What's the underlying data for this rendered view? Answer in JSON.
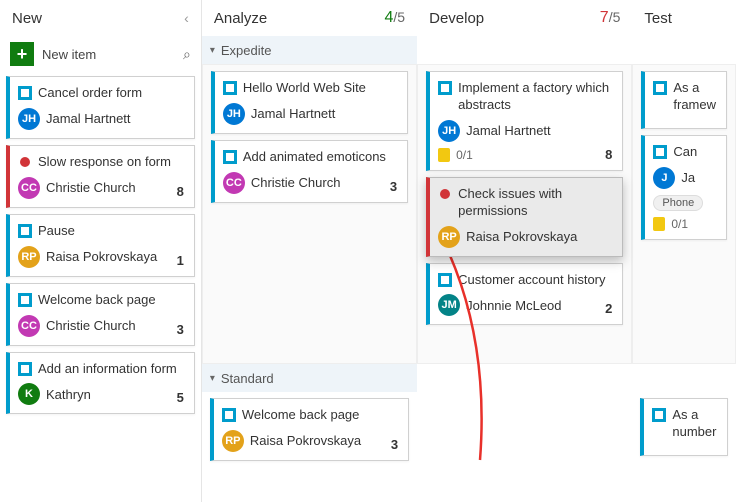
{
  "columns": {
    "new": {
      "title": "New"
    },
    "analyze": {
      "title": "Analyze",
      "wip_num": "4",
      "wip_den": "/5"
    },
    "develop": {
      "title": "Develop",
      "wip_num": "7",
      "wip_den": "/5"
    },
    "test": {
      "title": "Test"
    }
  },
  "newitem_label": "New item",
  "swimlanes": {
    "expedite": "Expedite",
    "standard": "Standard"
  },
  "cards": {
    "n1": {
      "title": "Cancel order form",
      "assignee": "Jamal Hartnett"
    },
    "n2": {
      "title": "Slow response on form",
      "assignee": "Christie Church",
      "count": "8"
    },
    "n3": {
      "title": "Pause",
      "assignee": "Raisa Pokrovskaya",
      "count": "1"
    },
    "n4": {
      "title": "Welcome back page",
      "assignee": "Christie Church",
      "count": "3"
    },
    "n5": {
      "title": "Add an information form",
      "assignee": "Kathryn",
      "count": "5"
    },
    "a1": {
      "title": "Hello World Web Site",
      "assignee": "Jamal Hartnett"
    },
    "a2": {
      "title": "Add animated emoticons",
      "assignee": "Christie Church",
      "count": "3"
    },
    "a3": {
      "title": "Welcome back page",
      "assignee": "Raisa Pokrovskaya",
      "count": "3"
    },
    "d1": {
      "title": "Implement a factory which abstracts",
      "assignee": "Jamal Hartnett",
      "count": "8",
      "task": "0/1"
    },
    "d2": {
      "title": "Check issues with permissions",
      "assignee": "Raisa Pokrovskaya"
    },
    "d3": {
      "title": "Customer account history",
      "assignee": "Johnnie McLeod",
      "count": "2"
    },
    "t1": {
      "title": "As a",
      "title2": "framew"
    },
    "t2": {
      "title": "Can",
      "assignee": "Ja",
      "tag": "Phone",
      "task": "0/1"
    },
    "t3": {
      "title": "As a",
      "title2": "number"
    }
  },
  "avatar_colors": {
    "jamal": "#0078d4",
    "christie": "#c239b3",
    "raisa": "#e3a21a",
    "johnnie": "#038387",
    "kathryn": "#107c10",
    "ja": "#0078d4"
  }
}
